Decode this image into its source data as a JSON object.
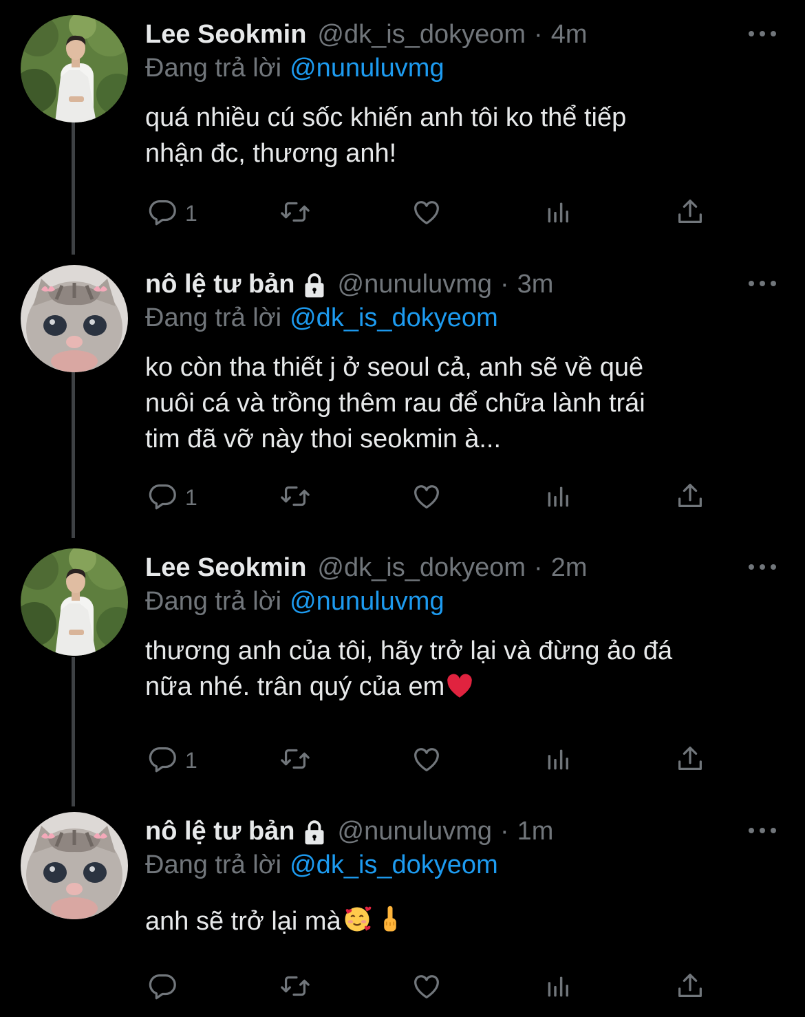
{
  "tweets": [
    {
      "name": "Lee Seokmin",
      "locked": false,
      "handle": "@dk_is_dokyeom",
      "time": "4m",
      "replying_label": "Đang trả lời",
      "replying_to": "@nunuluvmg",
      "text": "quá nhiều cú sốc khiến anh tôi ko thể tiếp\nnhận đc, thương anh!",
      "reply_count": "1",
      "avatar": "person-photo"
    },
    {
      "name": "nô lệ tư bản",
      "locked": true,
      "handle": "@nunuluvmg",
      "time": "3m",
      "replying_label": "Đang trả lời",
      "replying_to": "@dk_is_dokyeom",
      "text": "ko còn tha thiết j ở seoul cả, anh sẽ về quê\nnuôi cá và trồng thêm rau để chữa lành trái\ntim đã vỡ này thoi seokmin à...",
      "reply_count": "1",
      "avatar": "kitten-photo"
    },
    {
      "name": "Lee Seokmin",
      "locked": false,
      "handle": "@dk_is_dokyeom",
      "time": "2m",
      "replying_label": "Đang trả lời",
      "replying_to": "@nunuluvmg",
      "text": "thương anh của tôi, hãy trở lại và đừng ảo đá\nnữa nhé. trân quý của em",
      "text_emoji": "heart",
      "reply_count": "1",
      "avatar": "person-photo"
    },
    {
      "name": "nô lệ tư bản",
      "locked": true,
      "handle": "@nunuluvmg",
      "time": "1m",
      "replying_label": "Đang trả lời",
      "replying_to": "@dk_is_dokyeom",
      "text": "anh sẽ trở lại mà",
      "text_emoji": "smiling-hearts-and-finger",
      "reply_count": "",
      "avatar": "kitten-photo"
    }
  ],
  "colors": {
    "background": "#000000",
    "text": "#e7e9ea",
    "secondary": "#71767b",
    "link": "#1d9bf0",
    "thread_line": "#3e4144"
  }
}
